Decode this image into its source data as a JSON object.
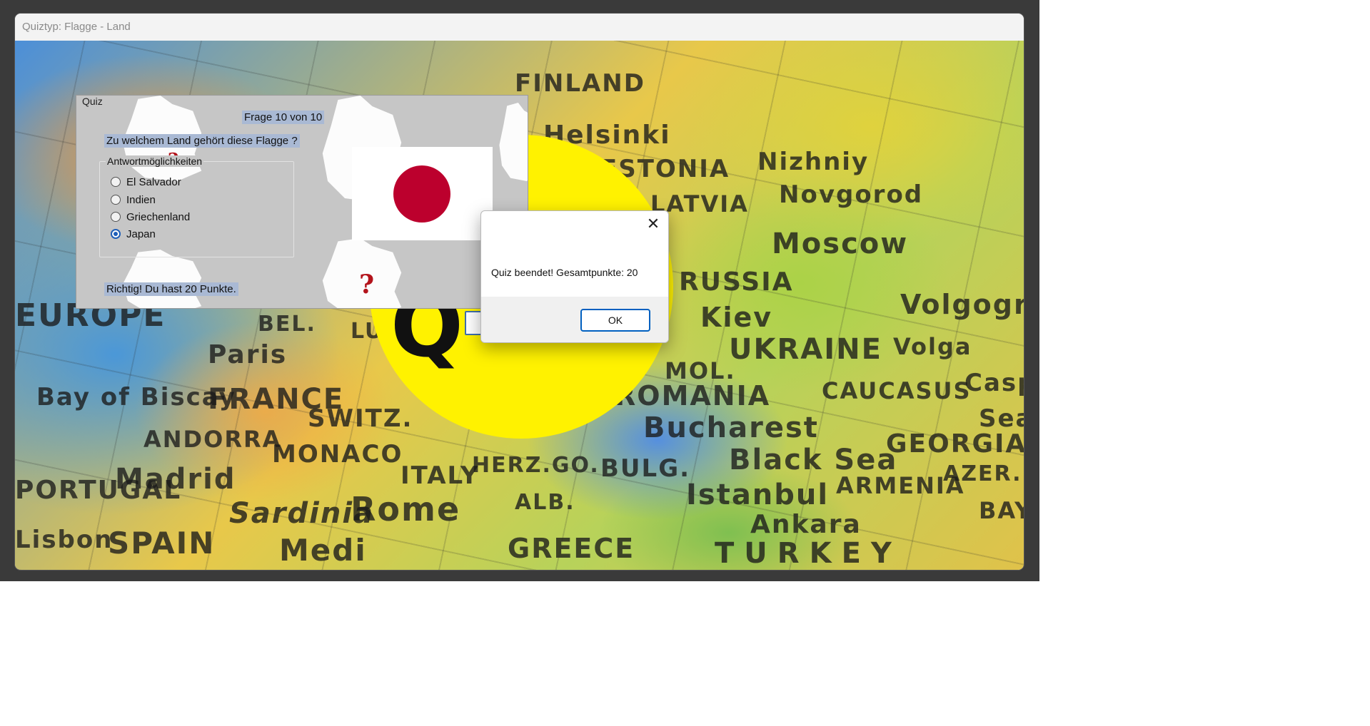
{
  "window": {
    "title": "Quiztyp: Flagge - Land"
  },
  "map_labels": [
    "FINLAND",
    "Helsinki",
    "ESTONIA",
    "LATVIA",
    "Nizhniy",
    "Novgorod",
    "Moscow",
    "RUSSIA",
    "Kiev",
    "UKRAINE",
    "Volgograd",
    "Volga",
    "CAUCASUS",
    "Caspi",
    "Sea",
    "MOL.",
    "ROMANIA",
    "Bucharest",
    "Black Sea",
    "GEORGIA",
    "ARMENIA",
    "AZER.",
    "BAYD",
    "Istanbul",
    "Ankara",
    "TURKEY",
    "BULG.",
    "GREECE",
    "ALB.",
    "HERZ.GO.",
    "ITALY",
    "Rome",
    "Sardinia",
    "Medi",
    "SWITZ.",
    "MONACO",
    "FRANCE",
    "Paris",
    "Bay of Biscay",
    "ANDORRA",
    "Madrid",
    "SPAIN",
    "PORTUGAL",
    "Lisbon",
    "EUROPE",
    "BEL.",
    "LU"
  ],
  "quiz": {
    "panel_title": "Quiz",
    "progress": "Frage 10 von 10",
    "question": "Zu welchem Land gehört diese Flagge ?",
    "answer_group_title": "Antwortmöglichkeiten",
    "options": [
      {
        "label": "El Salvador",
        "selected": false
      },
      {
        "label": "Indien",
        "selected": false
      },
      {
        "label": "Griechenland",
        "selected": false
      },
      {
        "label": "Japan",
        "selected": true
      }
    ],
    "result": "Richtig! Du hast 20 Punkte.",
    "flag_colors": {
      "field": "#ffffff",
      "disc": "#bc002d"
    }
  },
  "message_box": {
    "message": "Quiz beendet! Gesamtpunkte: 20",
    "ok_label": "OK",
    "close_glyph": "✕"
  },
  "colors": {
    "label_highlight": "#a9b9d4",
    "panel_bg": "#c6c6c6",
    "splash_yellow": "#fff200",
    "accent_blue": "#0060c0"
  }
}
